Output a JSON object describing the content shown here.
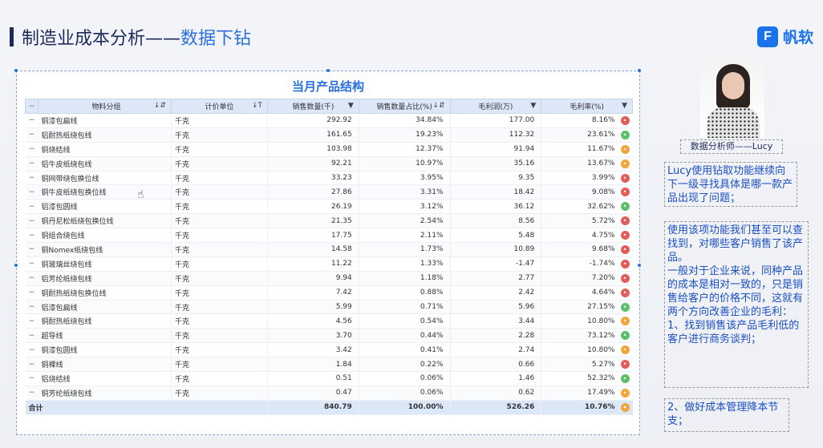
{
  "header": {
    "title_main": "制造业成本分析——",
    "title_sub": "数据下钻",
    "logo_text": "帆软"
  },
  "report": {
    "title": "当月产品结构",
    "columns": [
      "物料分组",
      "计价单位",
      "销售数量(千)",
      "销售数量占比(%)",
      "毛利润(万)",
      "毛利率(%)"
    ],
    "rows": [
      {
        "name": "铜漆包扁线",
        "unit": "千克",
        "qty": "292.92",
        "pct": "34.84%",
        "profit": "177.00",
        "rate": "8.16%",
        "face": "red"
      },
      {
        "name": "铝耐热纸绕包线",
        "unit": "千克",
        "qty": "161.65",
        "pct": "19.23%",
        "profit": "112.32",
        "rate": "23.61%",
        "face": "green"
      },
      {
        "name": "铜烧结线",
        "unit": "千克",
        "qty": "103.98",
        "pct": "12.37%",
        "profit": "91.94",
        "rate": "11.67%",
        "face": "orange"
      },
      {
        "name": "铝牛皮纸绕包线",
        "unit": "千克",
        "qty": "92.21",
        "pct": "10.97%",
        "profit": "35.16",
        "rate": "13.67%",
        "face": "orange"
      },
      {
        "name": "铜网带绕包换位线",
        "unit": "千克",
        "qty": "33.23",
        "pct": "3.95%",
        "profit": "9.35",
        "rate": "3.99%",
        "face": "red"
      },
      {
        "name": "铜牛皮纸绕包换位线",
        "unit": "千克",
        "qty": "27.86",
        "pct": "3.31%",
        "profit": "18.42",
        "rate": "9.08%",
        "face": "red"
      },
      {
        "name": "铝漆包圆线",
        "unit": "千克",
        "qty": "26.19",
        "pct": "3.12%",
        "profit": "36.12",
        "rate": "32.62%",
        "face": "green"
      },
      {
        "name": "铜丹尼松纸绕包换位线",
        "unit": "千克",
        "qty": "21.35",
        "pct": "2.54%",
        "profit": "8.56",
        "rate": "5.72%",
        "face": "red"
      },
      {
        "name": "铜组合绕包线",
        "unit": "千克",
        "qty": "17.75",
        "pct": "2.11%",
        "profit": "5.48",
        "rate": "4.75%",
        "face": "red"
      },
      {
        "name": "铜Nomex纸绕包线",
        "unit": "千克",
        "qty": "14.58",
        "pct": "1.73%",
        "profit": "10.89",
        "rate": "9.68%",
        "face": "red"
      },
      {
        "name": "铜玻璃丝绕包线",
        "unit": "千克",
        "qty": "11.22",
        "pct": "1.33%",
        "profit": "-1.47",
        "rate": "-1.74%",
        "face": "red"
      },
      {
        "name": "铝芳纶纸绕包线",
        "unit": "千克",
        "qty": "9.94",
        "pct": "1.18%",
        "profit": "2.77",
        "rate": "7.20%",
        "face": "red"
      },
      {
        "name": "铜耐热纸绕包换位线",
        "unit": "千克",
        "qty": "7.42",
        "pct": "0.88%",
        "profit": "2.42",
        "rate": "4.64%",
        "face": "red"
      },
      {
        "name": "铝漆包扁线",
        "unit": "千克",
        "qty": "5.99",
        "pct": "0.71%",
        "profit": "5.96",
        "rate": "27.15%",
        "face": "green"
      },
      {
        "name": "铜耐热纸绕包线",
        "unit": "千克",
        "qty": "4.56",
        "pct": "0.54%",
        "profit": "3.44",
        "rate": "10.80%",
        "face": "orange"
      },
      {
        "name": "超导线",
        "unit": "千克",
        "qty": "3.70",
        "pct": "0.44%",
        "profit": "2.28",
        "rate": "73.12%",
        "face": "green"
      },
      {
        "name": "铜漆包圆线",
        "unit": "千克",
        "qty": "3.42",
        "pct": "0.41%",
        "profit": "2.74",
        "rate": "10.80%",
        "face": "orange"
      },
      {
        "name": "铜裸线",
        "unit": "千克",
        "qty": "1.84",
        "pct": "0.22%",
        "profit": "0.66",
        "rate": "5.27%",
        "face": "red"
      },
      {
        "name": "铝烧结线",
        "unit": "千克",
        "qty": "0.51",
        "pct": "0.06%",
        "profit": "1.46",
        "rate": "52.32%",
        "face": "green"
      },
      {
        "name": "铜芳纶纸绕包线",
        "unit": "千克",
        "qty": "0.47",
        "pct": "0.06%",
        "profit": "0.62",
        "rate": "17.49%",
        "face": "orange"
      }
    ],
    "total": {
      "label": "合计",
      "qty": "840.79",
      "pct": "100.00%",
      "profit": "526.26",
      "rate": "10.76%",
      "face": "orange"
    }
  },
  "sidebar": {
    "caption": "数据分析师——Lucy",
    "note1": "Lucy使用钻取功能继续向下一级寻找具体是哪一款产品出现了问题；",
    "note2": "使用该项功能我们甚至可以查找到，对哪些客户销售了该产品。\n一般对于企业来说，同种产品的成本是相对一致的，只是销售给客户的价格不同，这就有两个方向改善企业的毛利：\n1、找到销售该产品毛利低的客户进行商务谈判；",
    "note3": "2、做好成本管理降本节支；"
  },
  "colors": {
    "accent": "#2a6fdb",
    "header_bg": "#dce7f7",
    "red": "#e45b5b",
    "green": "#5cbf6a",
    "orange": "#f0a63a"
  }
}
